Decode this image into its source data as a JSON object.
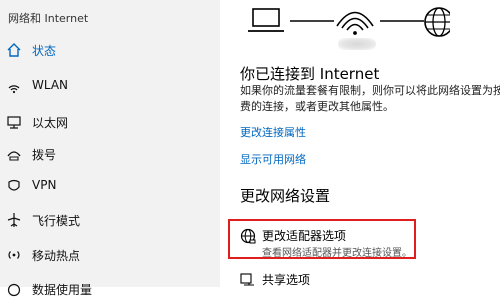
{
  "sidebar": {
    "header": "网络和 Internet",
    "items": [
      {
        "label": "状态",
        "icon": "home-icon",
        "active": true
      },
      {
        "label": "WLAN",
        "icon": "wifi-icon"
      },
      {
        "label": "以太网",
        "icon": "ethernet-icon"
      },
      {
        "label": "拨号",
        "icon": "dialup-icon"
      },
      {
        "label": "VPN",
        "icon": "vpn-icon"
      },
      {
        "label": "飞行模式",
        "icon": "airplane-icon"
      },
      {
        "label": "移动热点",
        "icon": "hotspot-icon"
      },
      {
        "label": "数据使用量",
        "icon": "data-usage-icon"
      }
    ]
  },
  "main": {
    "connected_heading": "你已连接到 Internet",
    "description_line1": "如果你的流量套餐有限制，则你可以将此网络设置为按",
    "description_line2": "费的连接，或者更改其他属性。",
    "link_change_properties": "更改连接属性",
    "link_show_networks": "显示可用网络",
    "change_settings_heading": "更改网络设置",
    "options": [
      {
        "title": "更改适配器选项",
        "subtitle": "查看网络适配器并更改连接设置。",
        "icon": "globe-adapter-icon",
        "highlighted": true
      },
      {
        "title": "共享选项",
        "subtitle": "",
        "icon": "sharing-icon"
      }
    ]
  },
  "colors": {
    "accent": "#0067c0",
    "highlight_border": "#e01e1e",
    "sidebar_bg": "#f2f2f2"
  }
}
